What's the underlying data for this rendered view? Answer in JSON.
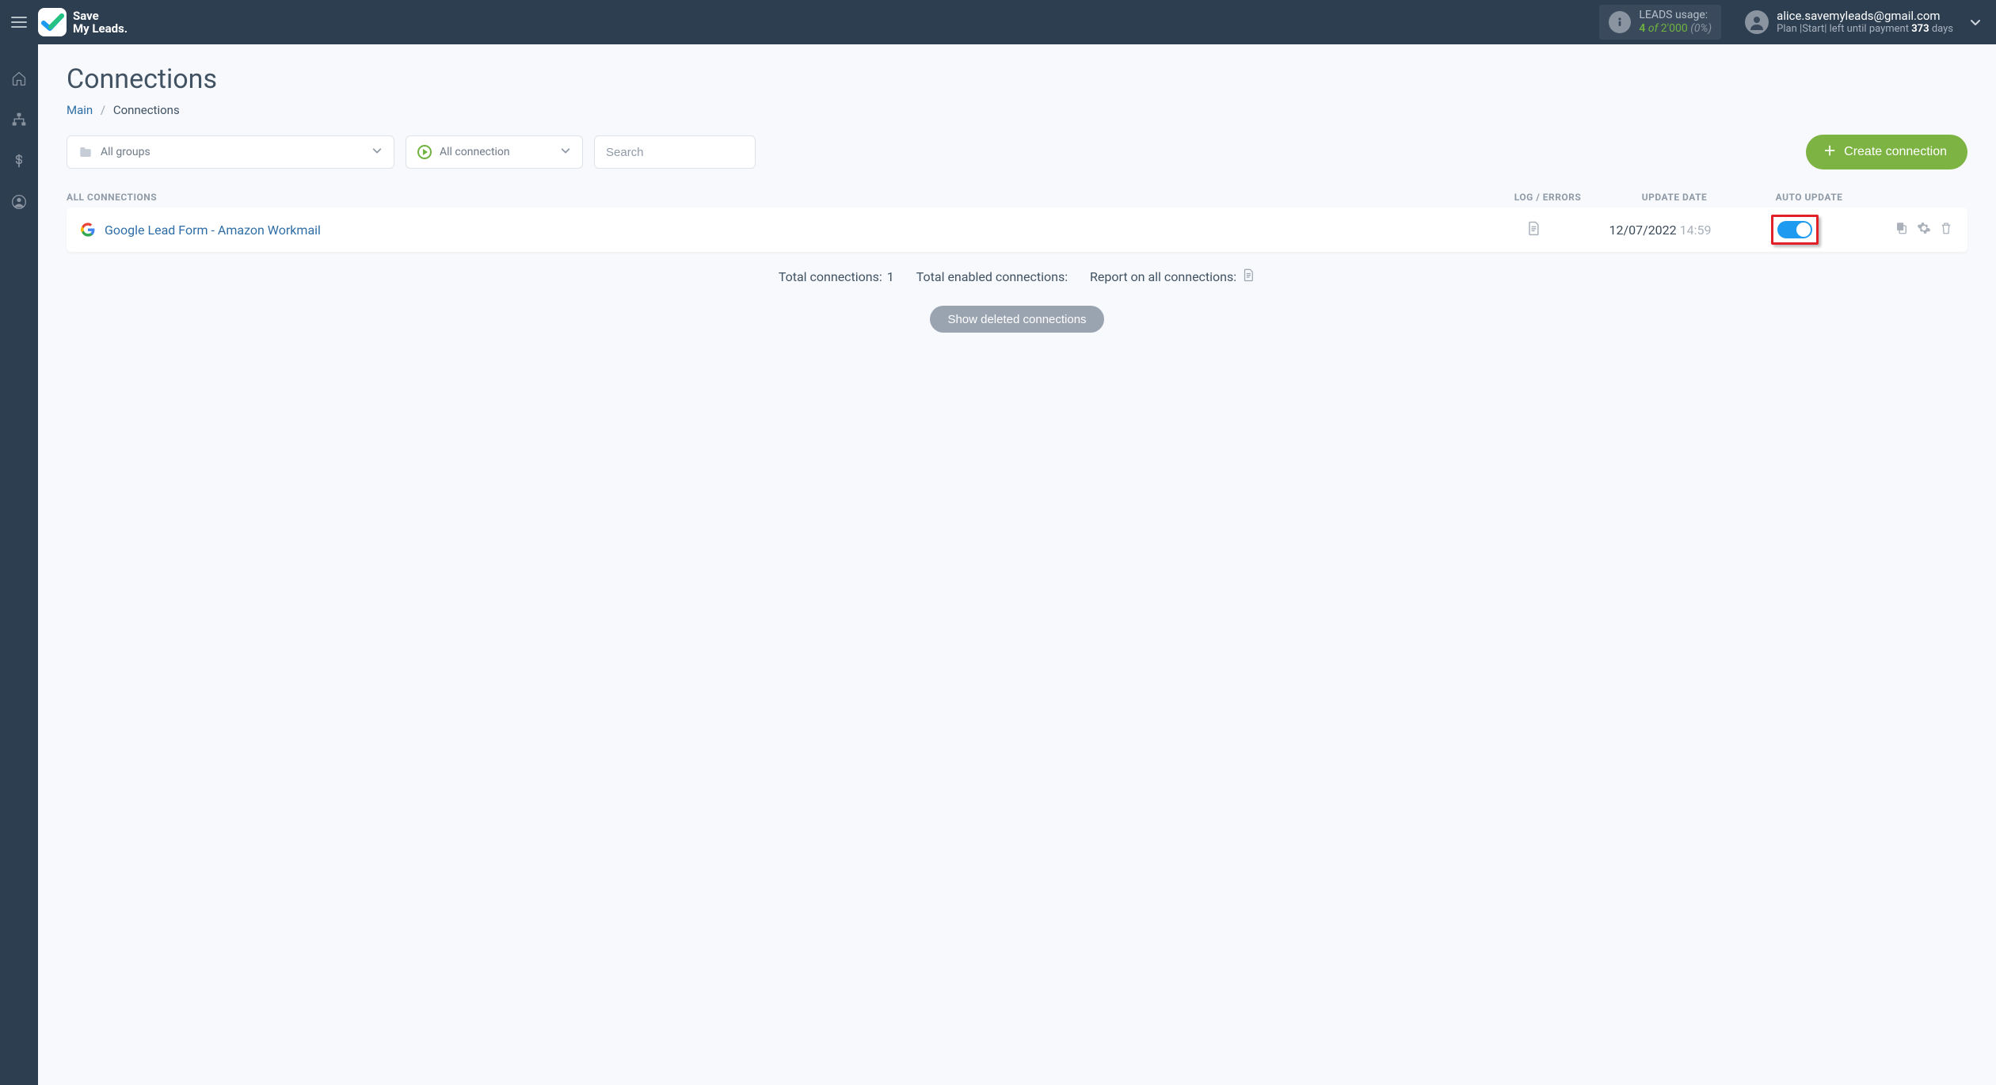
{
  "brand": {
    "line1": "Save",
    "line2": "My Leads."
  },
  "leads_usage": {
    "label": "LEADS usage:",
    "used": "4",
    "of_word": "of",
    "total": "2'000",
    "percent": "(0%)"
  },
  "user": {
    "email": "alice.savemyleads@gmail.com",
    "plan_prefix": "Plan |",
    "plan_name": "Start",
    "plan_mid": "| left until payment",
    "days_number": "373",
    "days_suffix": "days"
  },
  "page": {
    "title": "Connections"
  },
  "breadcrumb": {
    "main": "Main",
    "current": "Connections"
  },
  "filters": {
    "groups_label": "All groups",
    "conn_label": "All connection",
    "search_placeholder": "Search"
  },
  "actions": {
    "create_connection": "Create connection",
    "show_deleted": "Show deleted connections"
  },
  "columns": {
    "all_connections": "ALL CONNECTIONS",
    "log_errors": "LOG / ERRORS",
    "update_date": "UPDATE DATE",
    "auto_update": "AUTO UPDATE"
  },
  "rows": [
    {
      "name": "Google Lead Form - Amazon Workmail",
      "date": "12/07/2022",
      "time": "14:59",
      "auto_update": true
    }
  ],
  "summary": {
    "total_connections_label": "Total connections:",
    "total_connections_value": "1",
    "total_enabled_label": "Total enabled connections:",
    "report_label": "Report on all connections:"
  }
}
